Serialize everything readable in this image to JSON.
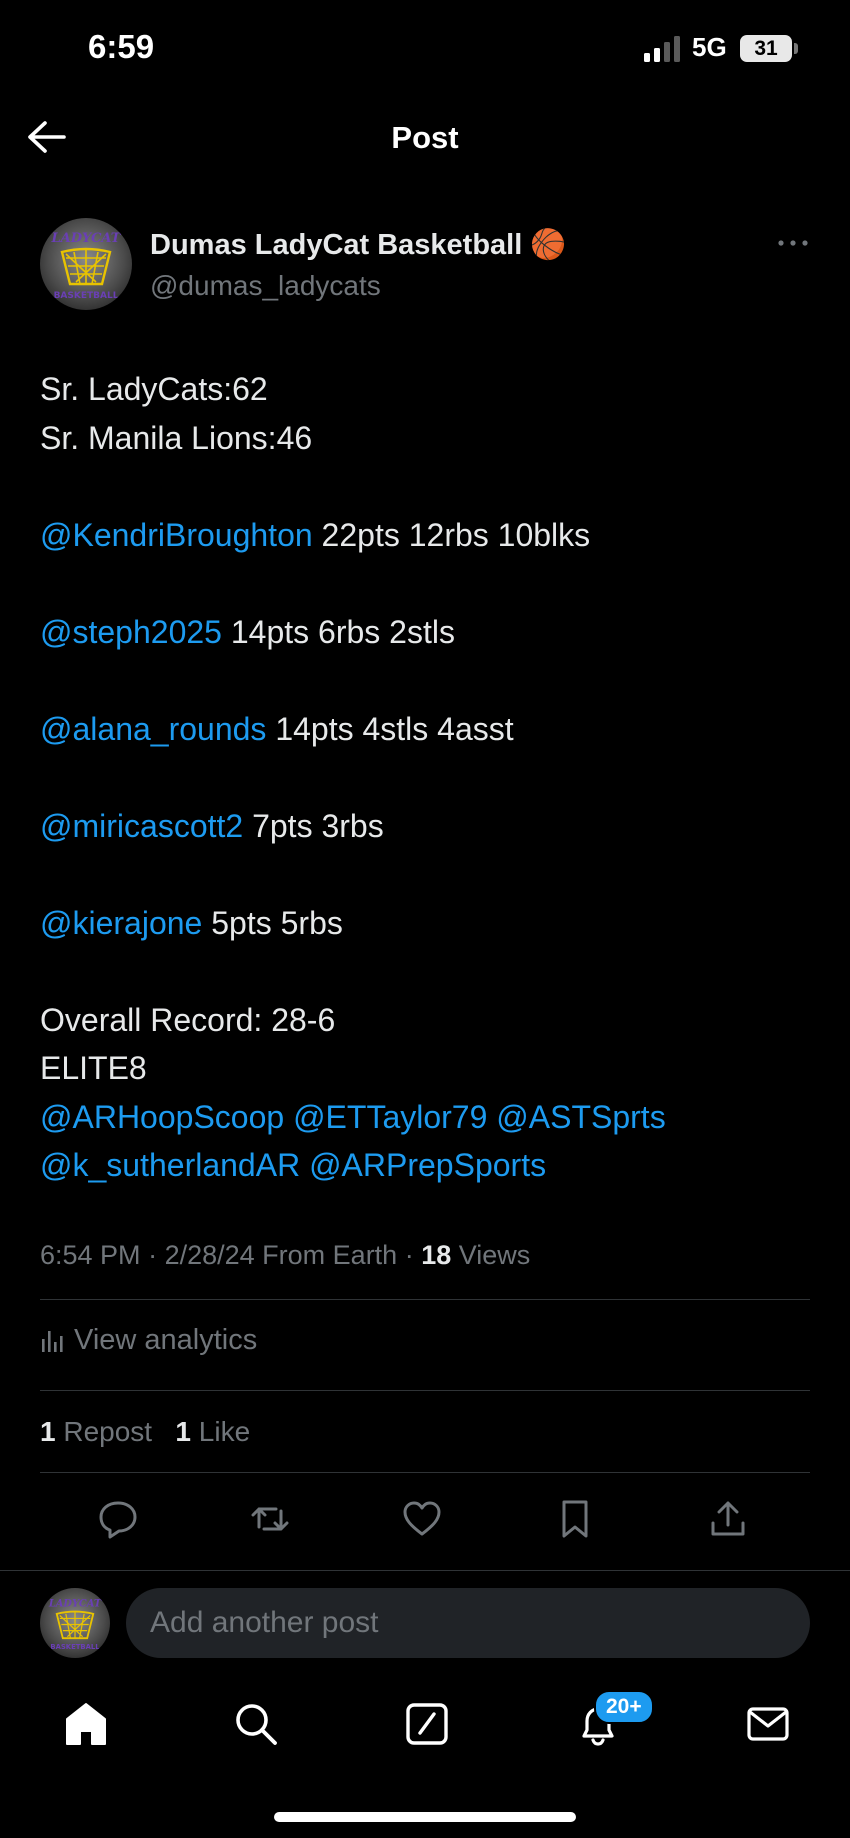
{
  "status_bar": {
    "time": "6:59",
    "network": "5G",
    "battery": "31"
  },
  "header": {
    "title": "Post"
  },
  "post": {
    "author_name": "Dumas LadyCat Basketball",
    "author_emoji": "🏀",
    "handle": "@dumas_ladycats",
    "avatar_text": {
      "top": "LADYCAT",
      "bottom": "BASKETBALL"
    },
    "lines": [
      {
        "text": "Sr. LadyCats:62"
      },
      {
        "text": "Sr. Manila Lions:46"
      },
      {
        "gap": true
      },
      {
        "mention": "@KendriBroughton",
        "text": " 22pts 12rbs 10blks"
      },
      {
        "gap": true
      },
      {
        "mention": "@steph2025",
        "text": " 14pts 6rbs 2stls"
      },
      {
        "gap": true
      },
      {
        "mention": "@alana_rounds",
        "text": " 14pts 4stls 4asst"
      },
      {
        "gap": true
      },
      {
        "mention": "@miricascott2",
        "text": " 7pts 3rbs"
      },
      {
        "gap": true
      },
      {
        "mention": "@kierajone",
        "text": " 5pts 5rbs"
      },
      {
        "gap": true
      },
      {
        "text": "Overall Record: 28-6"
      },
      {
        "text": "ELITE8"
      },
      {
        "mentions": [
          "@ARHoopScoop",
          "@ETTaylor79",
          "@ASTSprts"
        ]
      },
      {
        "mentions": [
          "@k_sutherlandAR",
          "@ARPrepSports"
        ]
      }
    ],
    "time": "6:54 PM",
    "date": "2/28/24",
    "source": "From Earth",
    "views_count": "18",
    "views_label": "Views",
    "analytics_label": "View analytics",
    "reposts_count": "1",
    "reposts_label": "Repost",
    "likes_count": "1",
    "likes_label": "Like"
  },
  "reply": {
    "placeholder": "Add another post"
  },
  "tabbar": {
    "notifications_badge": "20+"
  },
  "colors": {
    "accent": "#1d9bf0",
    "background": "#000000",
    "text": "#e7e9ea",
    "muted": "#71767b",
    "divider": "#2f3336"
  },
  "icons": [
    "back-arrow-icon",
    "more-icon",
    "analytics-icon",
    "reply-icon",
    "repost-icon",
    "like-icon",
    "bookmark-icon",
    "share-icon",
    "home-icon",
    "search-icon",
    "compose-icon",
    "notifications-icon",
    "messages-icon"
  ]
}
